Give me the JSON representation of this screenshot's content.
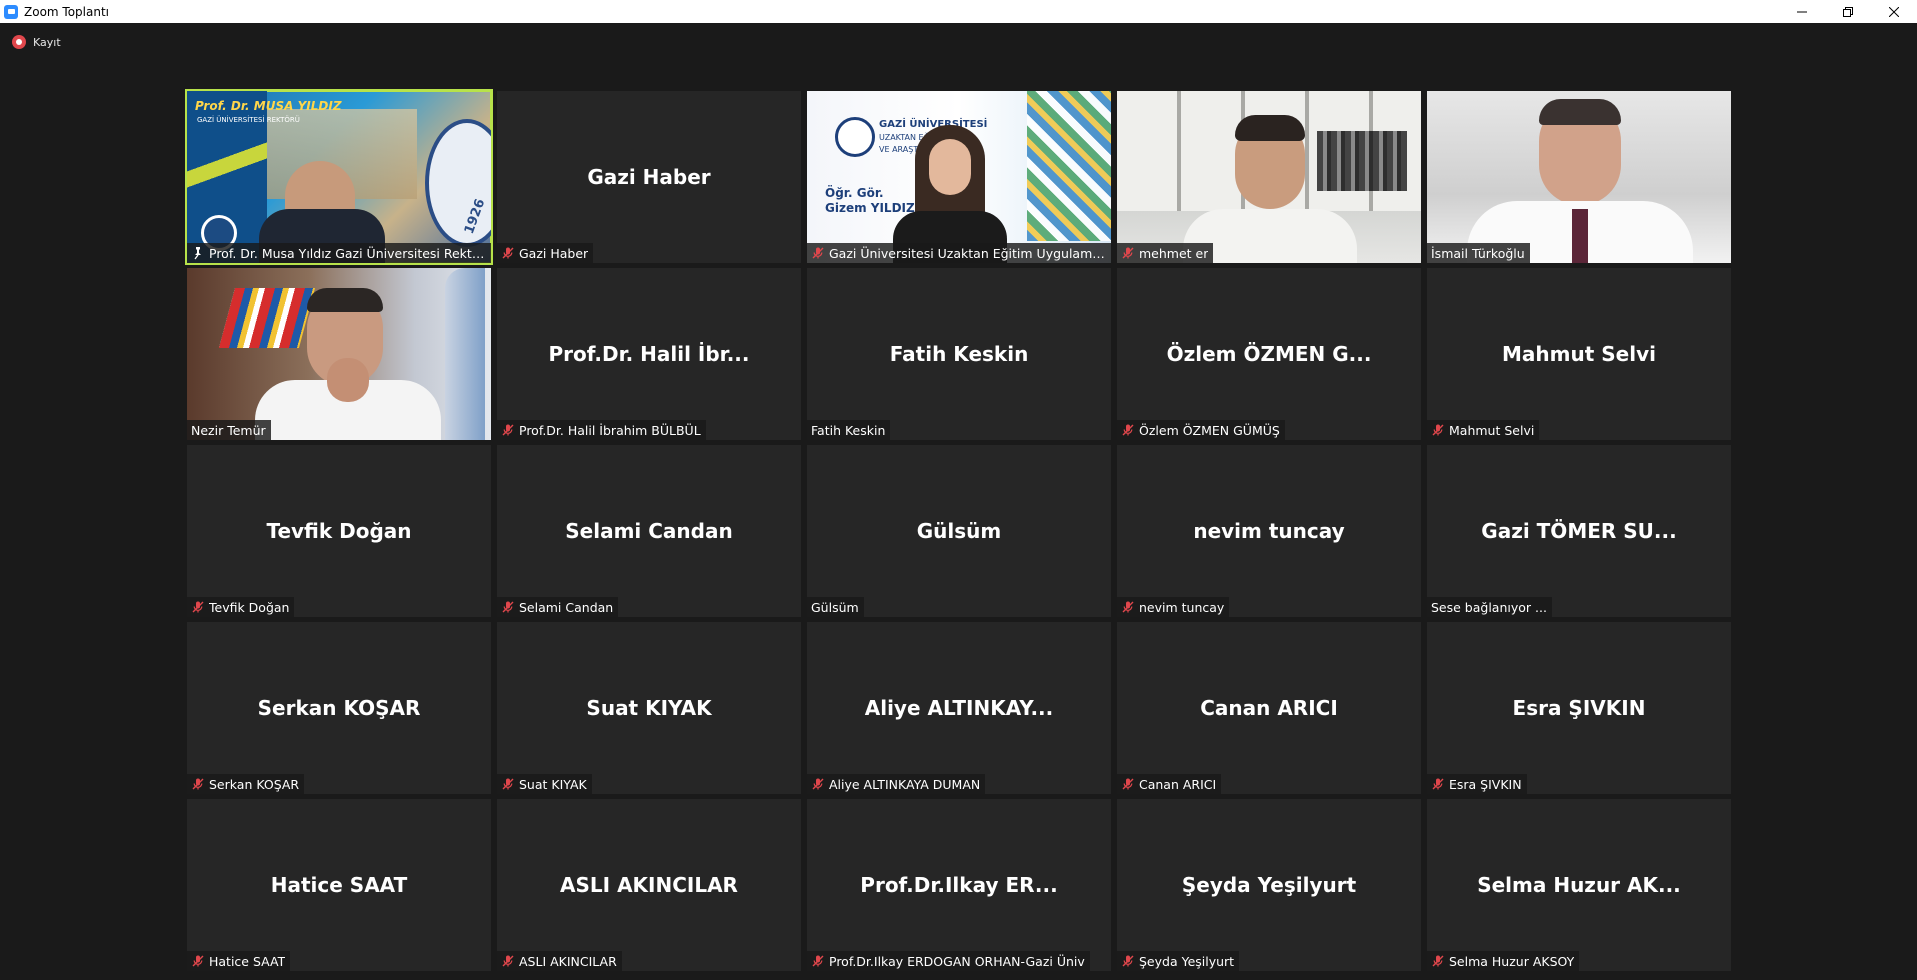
{
  "window": {
    "title": "Zoom Toplantı",
    "app_icon": "zoom-icon",
    "controls": [
      "minimize-icon",
      "restore-icon",
      "close-icon"
    ]
  },
  "recording": {
    "label": "Kayıt",
    "color": "#e0474c"
  },
  "accent": {
    "active_speaker": "#b7e24a",
    "muted_icon": "#e0474c",
    "tile_bg": "#262626",
    "page_bg": "#1a1a1a"
  },
  "tiles": [
    {
      "display": "",
      "nameplate": "Prof. Dr. Musa Yıldız Gazi Üniversitesi Rektörü",
      "video": true,
      "mic": "pin",
      "active": true
    },
    {
      "display": "Gazi Haber",
      "nameplate": "Gazi Haber",
      "video": false,
      "mic": "muted"
    },
    {
      "display": "",
      "nameplate": "Gazi Üniversitesi Uzaktan Eğitim Uygulama ve...",
      "video": true,
      "mic": "muted"
    },
    {
      "display": "",
      "nameplate": "mehmet er",
      "video": true,
      "mic": "muted"
    },
    {
      "display": "",
      "nameplate": "İsmail Türkoğlu",
      "video": true,
      "mic": "none"
    },
    {
      "display": "",
      "nameplate": "Nezir Temür",
      "video": true,
      "mic": "none"
    },
    {
      "display": "Prof.Dr. Halil İbr...",
      "nameplate": "Prof.Dr. Halil İbrahim BÜLBÜL",
      "video": false,
      "mic": "muted"
    },
    {
      "display": "Fatih Keskin",
      "nameplate": "Fatih Keskin",
      "video": false,
      "mic": "none"
    },
    {
      "display": "Özlem ÖZMEN G...",
      "nameplate": "Özlem ÖZMEN GÜMÜŞ",
      "video": false,
      "mic": "muted"
    },
    {
      "display": "Mahmut Selvi",
      "nameplate": "Mahmut Selvi",
      "video": false,
      "mic": "muted"
    },
    {
      "display": "Tevfik Doğan",
      "nameplate": "Tevfik Doğan",
      "video": false,
      "mic": "muted"
    },
    {
      "display": "Selami Candan",
      "nameplate": "Selami Candan",
      "video": false,
      "mic": "muted"
    },
    {
      "display": "Gülsüm",
      "nameplate": "Gülsüm",
      "video": false,
      "mic": "none"
    },
    {
      "display": "nevim tuncay",
      "nameplate": "nevim tuncay",
      "video": false,
      "mic": "muted"
    },
    {
      "display": "Gazi TÖMER SU...",
      "nameplate": "Sese bağlanıyor ...",
      "video": false,
      "mic": "none"
    },
    {
      "display": "Serkan KOŞAR",
      "nameplate": "Serkan KOŞAR",
      "video": false,
      "mic": "muted"
    },
    {
      "display": "Suat KIYAK",
      "nameplate": "Suat KIYAK",
      "video": false,
      "mic": "muted"
    },
    {
      "display": "Aliye  ALTINKAY...",
      "nameplate": "Aliye ALTINKAYA DUMAN",
      "video": false,
      "mic": "muted"
    },
    {
      "display": "Canan ARICI",
      "nameplate": "Canan ARICI",
      "video": false,
      "mic": "muted"
    },
    {
      "display": "Esra ŞIVKIN",
      "nameplate": "Esra ŞIVKIN",
      "video": false,
      "mic": "muted"
    },
    {
      "display": "Hatice SAAT",
      "nameplate": "Hatice SAAT",
      "video": false,
      "mic": "muted"
    },
    {
      "display": "ASLI AKINCILAR",
      "nameplate": "ASLI AKINCILAR",
      "video": false,
      "mic": "muted"
    },
    {
      "display": "Prof.Dr.Ilkay  ER...",
      "nameplate": "Prof.Dr.Ilkay ERDOGAN ORHAN-Gazi Üniv",
      "video": false,
      "mic": "muted"
    },
    {
      "display": "Şeyda Yeşilyurt",
      "nameplate": "Şeyda Yeşilyurt",
      "video": false,
      "mic": "muted"
    },
    {
      "display": "Selma  Huzur  AK...",
      "nameplate": "Selma Huzur AKSOY",
      "video": false,
      "mic": "muted"
    }
  ],
  "rector_banner": {
    "line1": "Prof. Dr. MUSA YILDIZ",
    "line2": "GAZİ ÜNİVERSİTESİ REKTÖRÜ",
    "seal": "1926"
  },
  "uzem_banner": {
    "line1": "GAZİ ÜNİVERSİTESİ",
    "line2": "UZAKTAN EĞ... MA",
    "line3": "VE ARAŞTIR...",
    "caption1": "Öğr. Gör.",
    "caption2": "Gizem YILDIZ"
  }
}
